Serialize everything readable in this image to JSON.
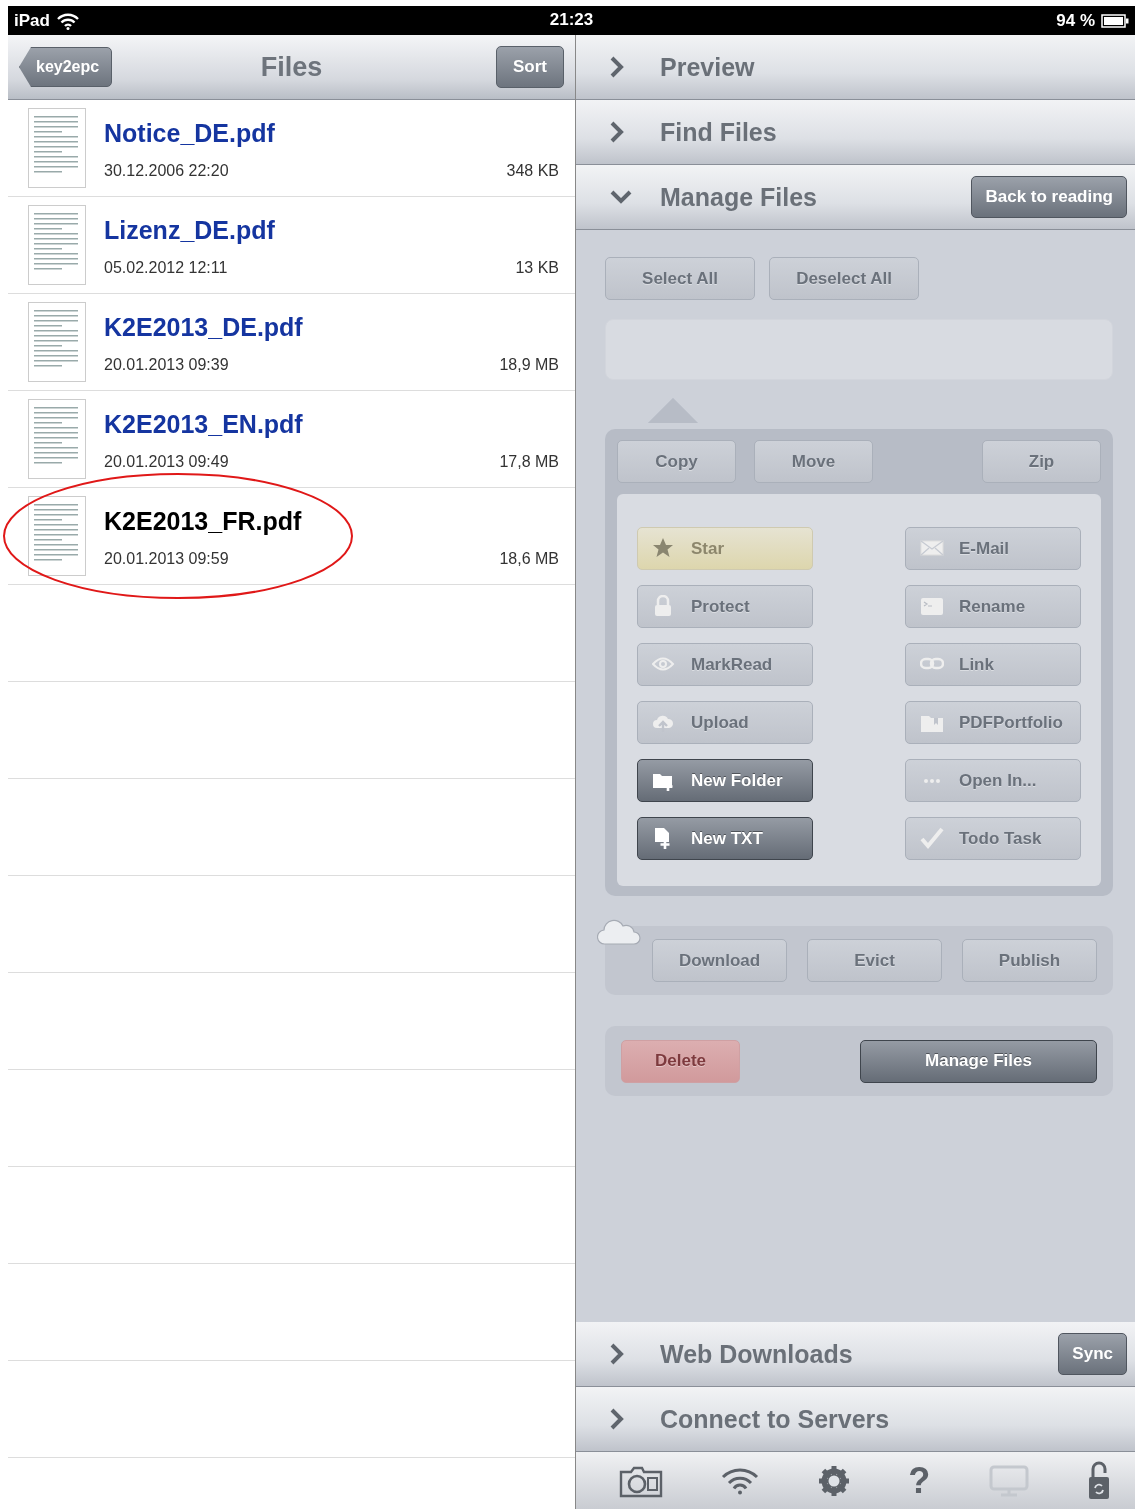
{
  "status_bar": {
    "device": "iPad",
    "time": "21:23",
    "battery": "94 %"
  },
  "files_pane": {
    "back_button": "key2epc",
    "title": "Files",
    "sort_button": "Sort",
    "files": [
      {
        "name": "Notice_DE.pdf",
        "date": "30.12.2006 22:20",
        "size": "348 KB",
        "selected": false,
        "circled": false
      },
      {
        "name": "Lizenz_DE.pdf",
        "date": "05.02.2012 12:11",
        "size": "13 KB",
        "selected": false,
        "circled": false
      },
      {
        "name": "K2E2013_DE.pdf",
        "date": "20.01.2013 09:39",
        "size": "18,9 MB",
        "selected": false,
        "circled": false
      },
      {
        "name": "K2E2013_EN.pdf",
        "date": "20.01.2013 09:49",
        "size": "17,8 MB",
        "selected": false,
        "circled": false
      },
      {
        "name": "K2E2013_FR.pdf",
        "date": "20.01.2013 09:59",
        "size": "18,6 MB",
        "selected": true,
        "circled": true
      }
    ]
  },
  "sections_top": [
    {
      "title": "Preview",
      "expanded": false
    },
    {
      "title": "Find Files",
      "expanded": false
    },
    {
      "title": "Manage Files",
      "expanded": true,
      "button": "Back to reading"
    }
  ],
  "manage": {
    "select_buttons": [
      {
        "label": "Select All",
        "disabled": true
      },
      {
        "label": "Deselect All",
        "disabled": true
      }
    ],
    "file_ops": [
      {
        "label": "Copy",
        "disabled": true
      },
      {
        "label": "Move",
        "disabled": true
      },
      {
        "label": "Zip",
        "disabled": true
      }
    ],
    "left_actions": [
      {
        "label": "Star",
        "starred": true,
        "disabled": true
      },
      {
        "label": "Protect",
        "starred": false,
        "disabled": true
      },
      {
        "label": "MarkRead",
        "starred": false,
        "disabled": true
      },
      {
        "label": "Upload",
        "starred": false,
        "disabled": true
      },
      {
        "label": "New Folder",
        "starred": false,
        "disabled": false
      },
      {
        "label": "New TXT",
        "starred": false,
        "disabled": false
      }
    ],
    "right_actions": [
      {
        "label": "E-Mail",
        "starred": false,
        "disabled": true
      },
      {
        "label": "Rename",
        "starred": false,
        "disabled": true
      },
      {
        "label": "Link",
        "starred": false,
        "disabled": true
      },
      {
        "label": "PDFPortfolio",
        "starred": false,
        "disabled": true
      },
      {
        "label": "Open In...",
        "starred": false,
        "disabled": true
      },
      {
        "label": "Todo Task",
        "starred": false,
        "disabled": true
      }
    ],
    "cloud_buttons": [
      {
        "label": "Download",
        "disabled": true
      },
      {
        "label": "Evict",
        "disabled": true
      },
      {
        "label": "Publish",
        "disabled": true
      }
    ],
    "delete_button": {
      "label": "Delete",
      "disabled": true
    },
    "manage_button": {
      "label": "Manage Files",
      "disabled": false
    }
  },
  "sections_bottom": [
    {
      "title": "Web Downloads",
      "expanded": false,
      "button": "Sync"
    },
    {
      "title": "Connect to Servers",
      "expanded": false
    }
  ],
  "toolbar": [
    {
      "disabled": false
    },
    {
      "disabled": false
    },
    {
      "disabled": false
    },
    {
      "glyph": "?",
      "disabled": false
    },
    {
      "disabled": true
    },
    {
      "disabled": false
    }
  ]
}
